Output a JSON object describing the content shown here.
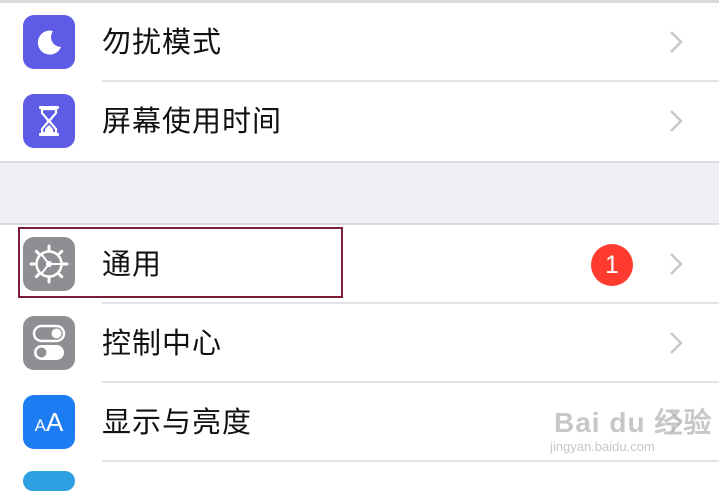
{
  "colors": {
    "dnd_icon_bg": "#5e5ce6",
    "screentime_icon_bg": "#5e5ce6",
    "general_icon_bg": "#8e8e93",
    "control_icon_bg": "#8e8e93",
    "display_icon_bg": "#1e7cf2",
    "next_icon_bg": "#2e9fe0",
    "badge_bg": "#ff3b30"
  },
  "settings": {
    "group1": [
      {
        "id": "do-not-disturb",
        "label": "勿扰模式",
        "icon": "moon-icon"
      },
      {
        "id": "screen-time",
        "label": "屏幕使用时间",
        "icon": "hourglass-icon"
      }
    ],
    "group2": [
      {
        "id": "general",
        "label": "通用",
        "icon": "gear-icon",
        "badge": "1"
      },
      {
        "id": "control-center",
        "label": "控制中心",
        "icon": "toggle-switches-icon"
      },
      {
        "id": "display-brightness",
        "label": "显示与亮度",
        "icon": "text-size-icon",
        "icon_text": "AA"
      }
    ]
  },
  "watermark": {
    "brand": "Bai du 经验",
    "url": "jingyan.baidu.com"
  }
}
